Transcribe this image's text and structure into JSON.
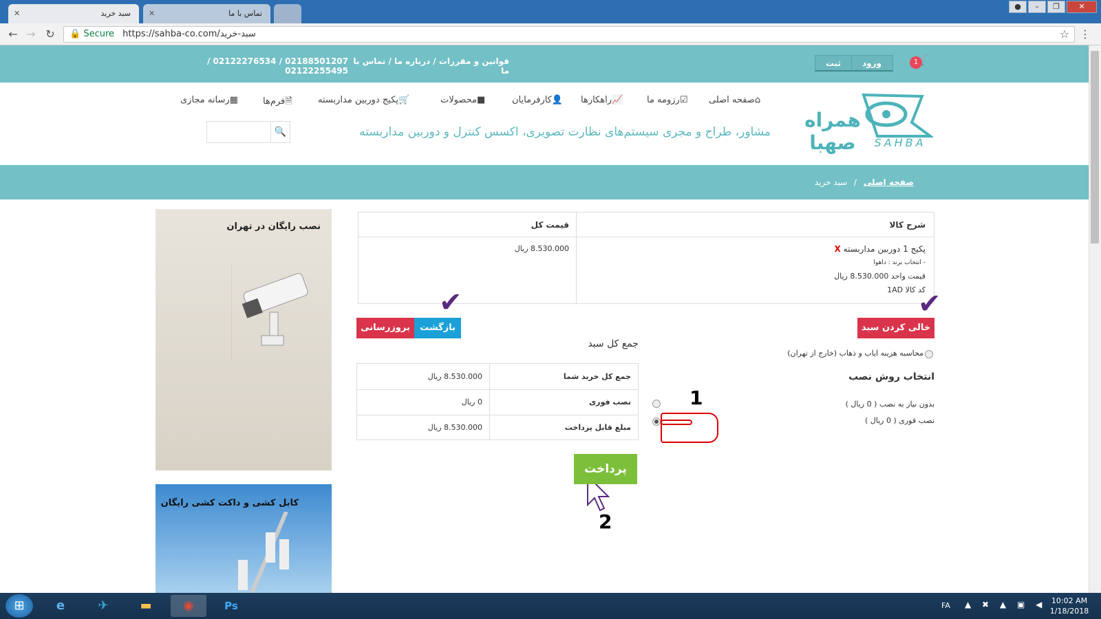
{
  "browser": {
    "tabs": [
      {
        "label": "سبد خرید",
        "active": true
      },
      {
        "label": "تماس با ما",
        "active": false
      },
      {
        "label": "",
        "active": false
      }
    ],
    "secure_label": "Secure",
    "url": "https://sahba-co.com/سبد-خرید"
  },
  "topbar": {
    "links": "قوانین و مقررات / درباره ما / تماس با ما",
    "phones": "02188501207 / 02122276534 / 02122255495",
    "login": "ورود",
    "register": "ثبت",
    "cart_count": "1"
  },
  "header": {
    "logo_text": "همراه صهبا",
    "logo_latin": "SAHBA",
    "tagline": "مشاور، طراح و مجری سیستم‌های نظارت تصویری، اکسس کنترل و دوربین مداربسته",
    "menu": [
      "صفحه اصلی",
      "رزومه ما",
      "راهکارها",
      "کارفرمایان",
      "محصولات",
      "پکیج دوربین مداربسته",
      "فرم‌ها",
      "رسانه مجازی"
    ]
  },
  "breadcrumb": {
    "home": "صفحه اصلی",
    "sep": "/",
    "current": "سبد خرید"
  },
  "cart_table": {
    "headers": {
      "desc": "شرح کالا",
      "total": "قیمت کل"
    },
    "item": {
      "name": "پکیج 1 دوربین مداربسته",
      "remove": "X",
      "brand": "- انتخاب برند : داهوا",
      "unit_price": "قیمت واحد 8.530.000 ریال",
      "code": "کد کالا 1AD",
      "total": "8.530.000 ریال"
    }
  },
  "buttons": {
    "empty_cart": "خالی کردن سبد",
    "back": "بازگشت",
    "update": "بروزرسانی",
    "pay": "پرداخت"
  },
  "shipping": {
    "label": "محاسبه هزینه ایاب و ذهاب (خارج از تهران)"
  },
  "install": {
    "title": "انتخاب روش نصب",
    "options": [
      "بدون نیاز به نصب ( 0 ریال )",
      "نصب فوری ( 0 ریال )"
    ],
    "selected": 1
  },
  "totals": {
    "title": "جمع کل سبد",
    "rows": [
      {
        "label": "جمع کل خرید شما",
        "value": "8.530.000 ریال"
      },
      {
        "label": "نصب فوری",
        "value": "0 ریال"
      },
      {
        "label": "مبلغ قابل پرداخت",
        "value": "8.530.000 ریال"
      }
    ]
  },
  "annotations": {
    "step1": "1",
    "step2": "2"
  },
  "sidebar": {
    "banner1": "نصب رایگان در تهران",
    "banner2": "کابل کشی و داکت کشی رایگان"
  },
  "taskbar": {
    "lang": "FA",
    "time": "10:02 AM",
    "date": "1/18/2018"
  },
  "colors": {
    "teal": "#73c0c6",
    "red": "#d9344b",
    "blue": "#1ba0d8",
    "green": "#7cbf3b",
    "purple": "#5a2a80"
  }
}
